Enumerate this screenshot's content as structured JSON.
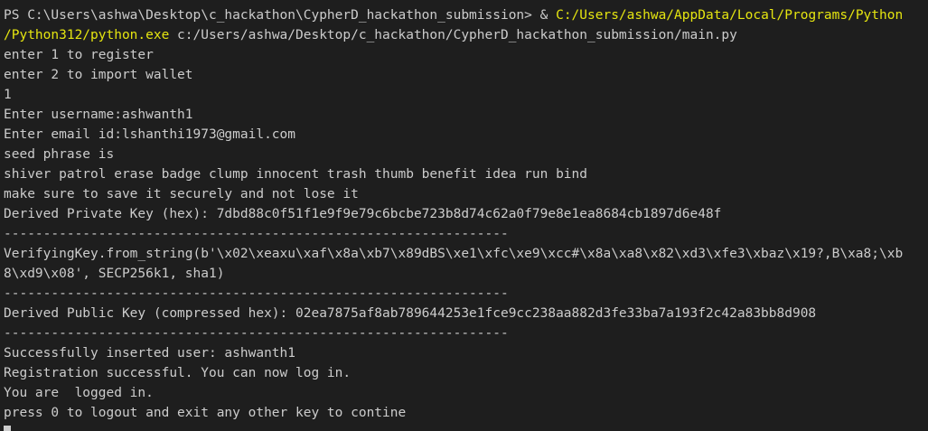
{
  "prompt": {
    "text": "PS C:\\Users\\ashwa\\Desktop\\c_hackathon\\CypherD_hackathon_submission> ",
    "operator": "& ",
    "exe_path_line1": "C:/Users/ashwa/AppData/Local/Programs/Python",
    "exe_path_line2": "/Python312/python.exe",
    "script_arg": " c:/Users/ashwa/Desktop/c_hackathon/CypherD_hackathon_submission/main.py"
  },
  "output_lines": [
    "enter 1 to register",
    "enter 2 to import wallet",
    "1",
    "Enter username:ashwanth1",
    "Enter email id:lshanthi1973@gmail.com",
    "seed phrase is",
    "shiver patrol erase badge clump innocent trash thumb benefit idea run bind",
    "make sure to save it securely and not lose it",
    "Derived Private Key (hex): 7dbd88c0f51f1e9f9e79c6bcbe723b8d74c62a0f79e8e1ea8684cb1897d6e48f",
    "----------------------------------------------------------------",
    "VerifyingKey.from_string(b'\\x02\\xeaxu\\xaf\\x8a\\xb7\\x89dBS\\xe1\\xfc\\xe9\\xcc#\\x8a\\xa8\\x82\\xd3\\xfe3\\xbaz\\x19?,B\\xa8;\\xb",
    "8\\xd9\\x08', SECP256k1, sha1)",
    "----------------------------------------------------------------",
    "Derived Public Key (compressed hex): 02ea7875af8ab789644253e1fce9cc238aa882d3fe33ba7a193f2c42a83bb8d908",
    "----------------------------------------------------------------",
    "Successfully inserted user: ashwanth1",
    "Registration successful. You can now log in.",
    "You are  logged in.",
    "press 0 to logout and exit any other key to contine"
  ],
  "colors": {
    "background": "#1e1e1e",
    "foreground": "#cccccc",
    "path_highlight": "#e5e510"
  }
}
